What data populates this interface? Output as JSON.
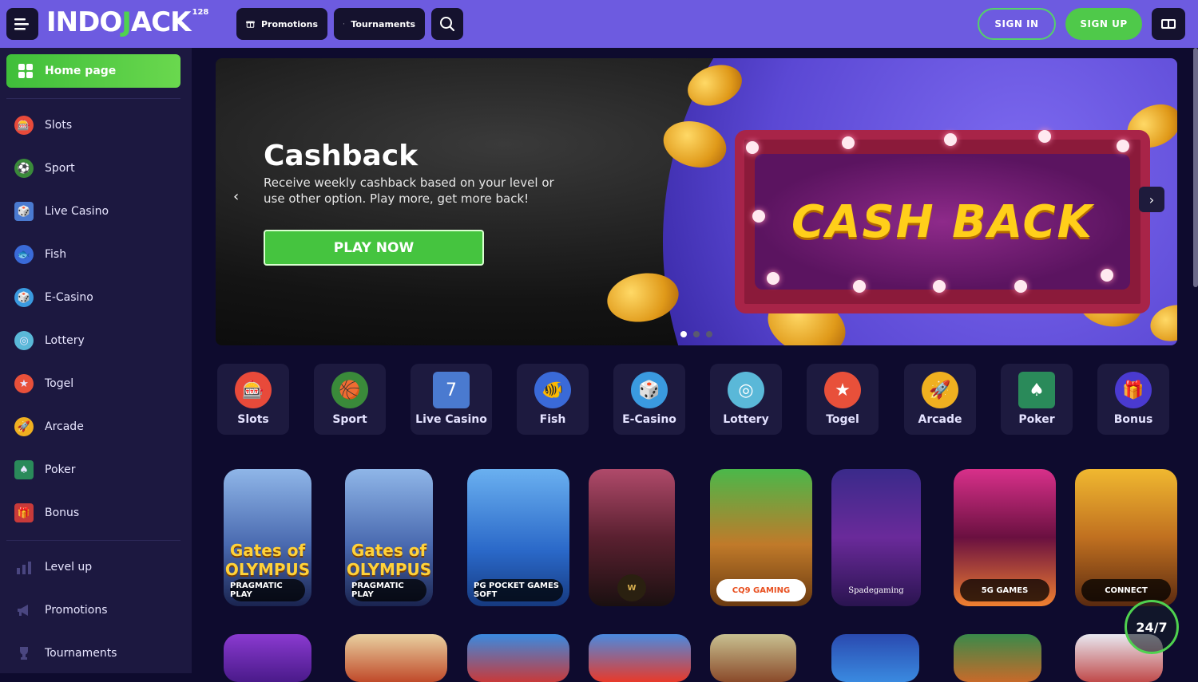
{
  "header": {
    "logo_text_a": "INDO",
    "logo_text_b": "J",
    "logo_text_c": "ACK",
    "logo_sup": "128",
    "promotions_label": "Promotions",
    "tournaments_label": "Tournaments",
    "signin_label": "SIGN IN",
    "signup_label": "SIGN UP",
    "accent_color": "#6d5be0"
  },
  "sidebar": {
    "home_label": "Home page",
    "items": [
      {
        "label": "Slots",
        "icon": "slot-machine-icon"
      },
      {
        "label": "Sport",
        "icon": "ball-icon"
      },
      {
        "label": "Live Casino",
        "icon": "live-casino-icon"
      },
      {
        "label": "Fish",
        "icon": "fish-icon"
      },
      {
        "label": "E-Casino",
        "icon": "dice-icon"
      },
      {
        "label": "Lottery",
        "icon": "lottery-wheel-icon"
      },
      {
        "label": "Togel",
        "icon": "star-icon"
      },
      {
        "label": "Arcade",
        "icon": "arcade-icon"
      },
      {
        "label": "Poker",
        "icon": "cards-icon"
      },
      {
        "label": "Bonus",
        "icon": "gift-icon"
      }
    ],
    "extra": [
      {
        "label": "Level up",
        "icon": "bar-chart-icon"
      },
      {
        "label": "Promotions",
        "icon": "megaphone-icon"
      },
      {
        "label": "Tournaments",
        "icon": "trophy-icon"
      }
    ]
  },
  "hero": {
    "title": "Cashback",
    "subtitle": "Receive weekly cashback based on your level or use other option. Play more, get more back!",
    "cta_label": "PLAY NOW",
    "billboard_text": "CASH BACK",
    "slide_count": 3,
    "active_slide": 1
  },
  "categories": [
    {
      "label": "Slots",
      "icon": "slot-machine-icon",
      "color": "#e84a3a"
    },
    {
      "label": "Sport",
      "icon": "ball-icon",
      "color": "#3aa04a"
    },
    {
      "label": "Live Casino",
      "icon": "live-casino-icon",
      "color": "#4a8ad8"
    },
    {
      "label": "Fish",
      "icon": "fish-icon",
      "color": "#3a78e0"
    },
    {
      "label": "E-Casino",
      "icon": "dice-icon",
      "color": "#3a9ae0"
    },
    {
      "label": "Lottery",
      "icon": "lottery-wheel-icon",
      "color": "#5ab8d8"
    },
    {
      "label": "Togel",
      "icon": "star-icon",
      "color": "#e84a3a"
    },
    {
      "label": "Arcade",
      "icon": "arcade-icon",
      "color": "#f0b020"
    },
    {
      "label": "Poker",
      "icon": "cards-icon",
      "color": "#2a8a5a"
    },
    {
      "label": "Bonus",
      "icon": "gift-icon",
      "color": "#4a3ad0"
    }
  ],
  "games": [
    {
      "title": "Gates of OLYMPUS",
      "provider": "PRAGMATIC PLAY"
    },
    {
      "title": "Gates of OLYMPUS",
      "provider": "PRAGMATIC PLAY"
    },
    {
      "title": "",
      "provider": "PG POCKET GAMES SOFT"
    },
    {
      "title": "",
      "provider": "W"
    },
    {
      "title": "",
      "provider": "CQ9 GAMING"
    },
    {
      "title": "",
      "provider": "Spadegaming"
    },
    {
      "title": "",
      "provider": "5G GAMES"
    },
    {
      "title": "",
      "provider": "CONNECT"
    }
  ],
  "support_label": "24/7"
}
